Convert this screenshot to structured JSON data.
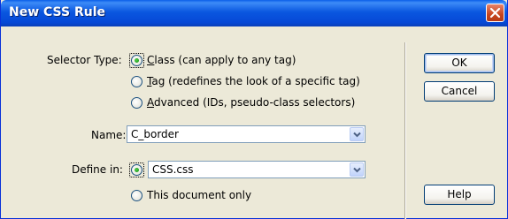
{
  "window": {
    "title": "New CSS Rule"
  },
  "selector_type": {
    "label": "Selector Type:",
    "options": [
      {
        "mnemonic": "C",
        "rest": "lass (can apply to any tag)",
        "selected": true
      },
      {
        "mnemonic": "T",
        "rest": "ag (redefines the look of a specific tag)",
        "selected": false
      },
      {
        "mnemonic": "A",
        "rest": "dvanced (IDs, pseudo-class selectors)",
        "selected": false
      }
    ]
  },
  "name": {
    "label": "Name:",
    "value": "C_border"
  },
  "define_in": {
    "label": "Define in:",
    "stylesheet_value": "CSS.css",
    "stylesheet_selected": true,
    "this_document_label": "This document only",
    "this_document_selected": false
  },
  "buttons": {
    "ok": "OK",
    "cancel": "Cancel",
    "help": "Help"
  },
  "colors": {
    "titlebar": "#0A57E0",
    "dialog_bg": "#ECE9D8",
    "radio_dot": "#21A121",
    "close": "#C7451F"
  }
}
